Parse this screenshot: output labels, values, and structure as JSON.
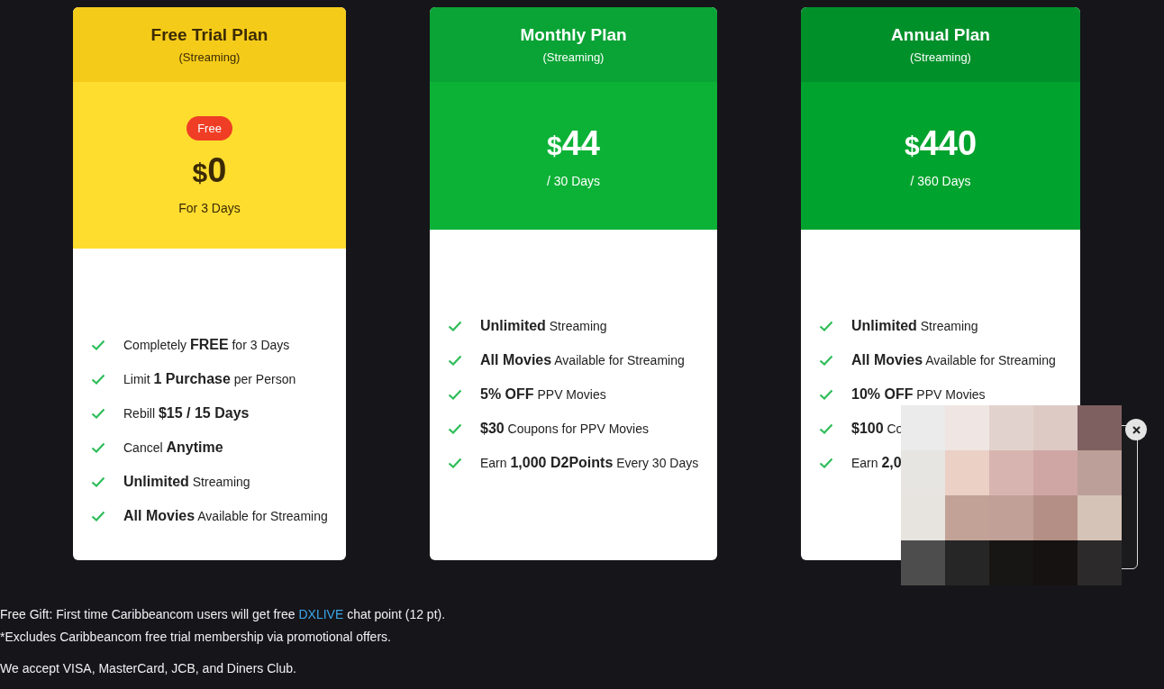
{
  "plans": [
    {
      "kind": "trial",
      "title": "Free Trial Plan",
      "subtitle": "(Streaming)",
      "badge": "Free",
      "currency": "$",
      "amount": "0",
      "period": "For 3 Days",
      "features": [
        "Completely **FREE** for 3 Days",
        "Limit **1 Purchase** per Person",
        "Rebill **$15 / 15 Days**",
        "Cancel **Anytime**",
        "**Unlimited** Streaming",
        "**All Movies** Available for Streaming"
      ]
    },
    {
      "kind": "monthly",
      "title": "Monthly Plan",
      "subtitle": "(Streaming)",
      "currency": "$",
      "amount": "44",
      "period": "/ 30 Days",
      "features": [
        "**Unlimited** Streaming",
        "**All Movies** Available for Streaming",
        "**5% OFF** PPV Movies",
        "**$30** Coupons for PPV Movies",
        "Earn **1,000 D2Points** Every 30 Days"
      ]
    },
    {
      "kind": "annual",
      "title": "Annual Plan",
      "subtitle": "(Streaming)",
      "currency": "$",
      "amount": "440",
      "period": "/ 360 Days",
      "features": [
        "**Unlimited** Streaming",
        "**All Movies** Available for Streaming",
        "**10% OFF** PPV Movies",
        "**$100** Co",
        "Earn **2,0**"
      ]
    }
  ],
  "footer": {
    "gift_before": "Free Gift: First time Caribbeancom users will get free",
    "gift_link": "DXLIVE",
    "gift_after": "chat point (12 pt).",
    "note": "*Excludes Caribbeancom free trial membership via promotional offers.",
    "payment": "We accept VISA, MasterCard, JCB, and Diners Club."
  }
}
